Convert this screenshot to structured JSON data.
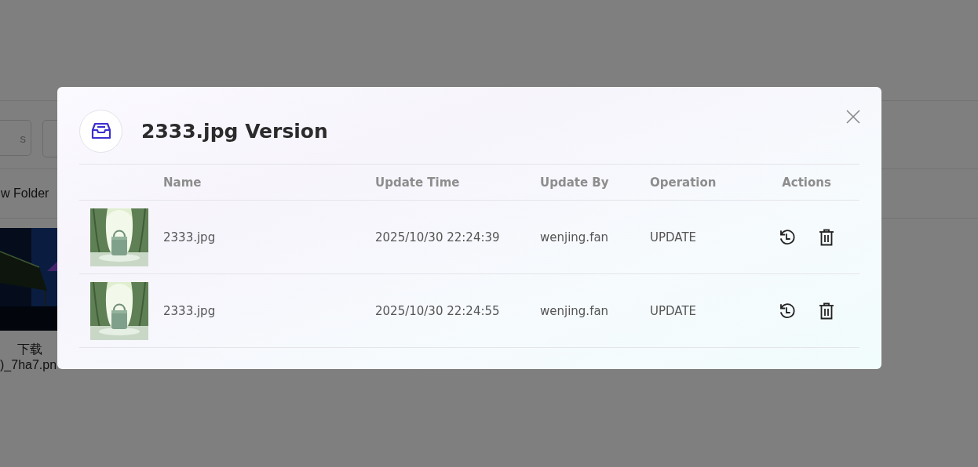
{
  "background_page": {
    "search_field": {
      "placeholder": "s"
    },
    "new_folder_button": {
      "label": "w Folder"
    },
    "file_card": {
      "label": "下载",
      "file_name": ")_7ha7.pn"
    }
  },
  "dialog": {
    "title": "2333.jpg Version",
    "table": {
      "columns": [
        "Name",
        "Update Time",
        "Update By",
        "Operation",
        "Actions"
      ],
      "rows": [
        {
          "name": "2333.jpg",
          "update_time": "2025/10/30 22:24:39",
          "update_by": "wenjing.fan",
          "operation": "UPDATE"
        },
        {
          "name": "2333.jpg",
          "update_time": "2025/10/30 22:24:55",
          "update_by": "wenjing.fan",
          "operation": "UPDATE"
        }
      ]
    }
  }
}
